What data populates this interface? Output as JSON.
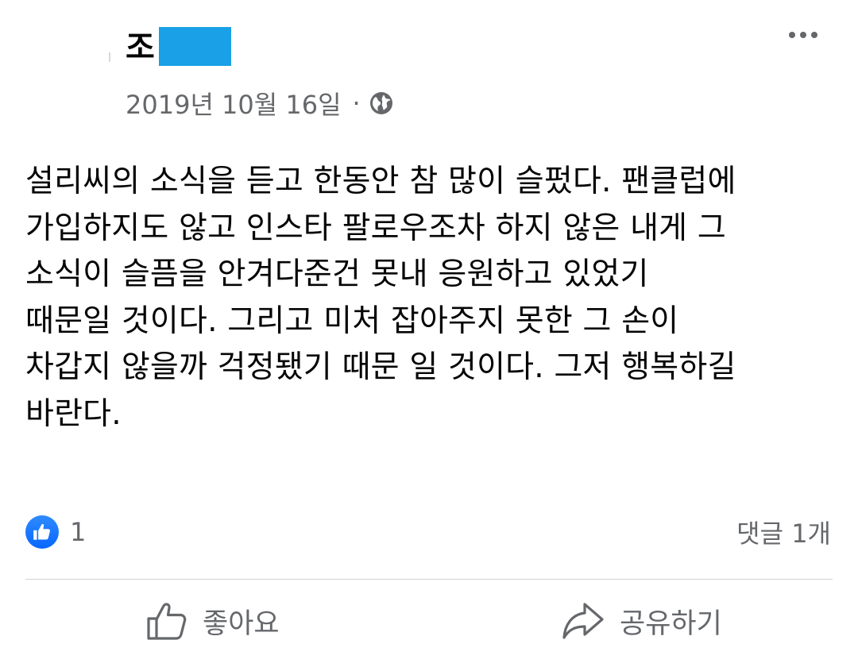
{
  "post": {
    "author_initial": "조",
    "date": "2019년 10월 16일",
    "meta_separator": "·",
    "privacy_icon": "globe-icon",
    "body": "설리씨의 소식을 듣고 한동안 참 많이 슬펐다. 팬클럽에\n가입하지도 않고 인스타 팔로우조차 하지 않은 내게 그\n소식이 슬픔을 안겨다준건 못내 응원하고 있었기\n때문일 것이다. 그리고 미처 잡아주지 못한 그 손이\n차갑지 않을까 걱정됐기 때문 일 것이다. 그저 행복하길\n바란다."
  },
  "reactions": {
    "count": "1",
    "icon": "like-badge-icon",
    "comment_count": "댓글 1개"
  },
  "actions": {
    "like_label": "좋아요",
    "share_label": "공유하기"
  },
  "colors": {
    "accent_blue": "#0866ff",
    "secondary_text": "#65676b",
    "primary_text": "#050505",
    "redaction": "#1aa0e6"
  }
}
